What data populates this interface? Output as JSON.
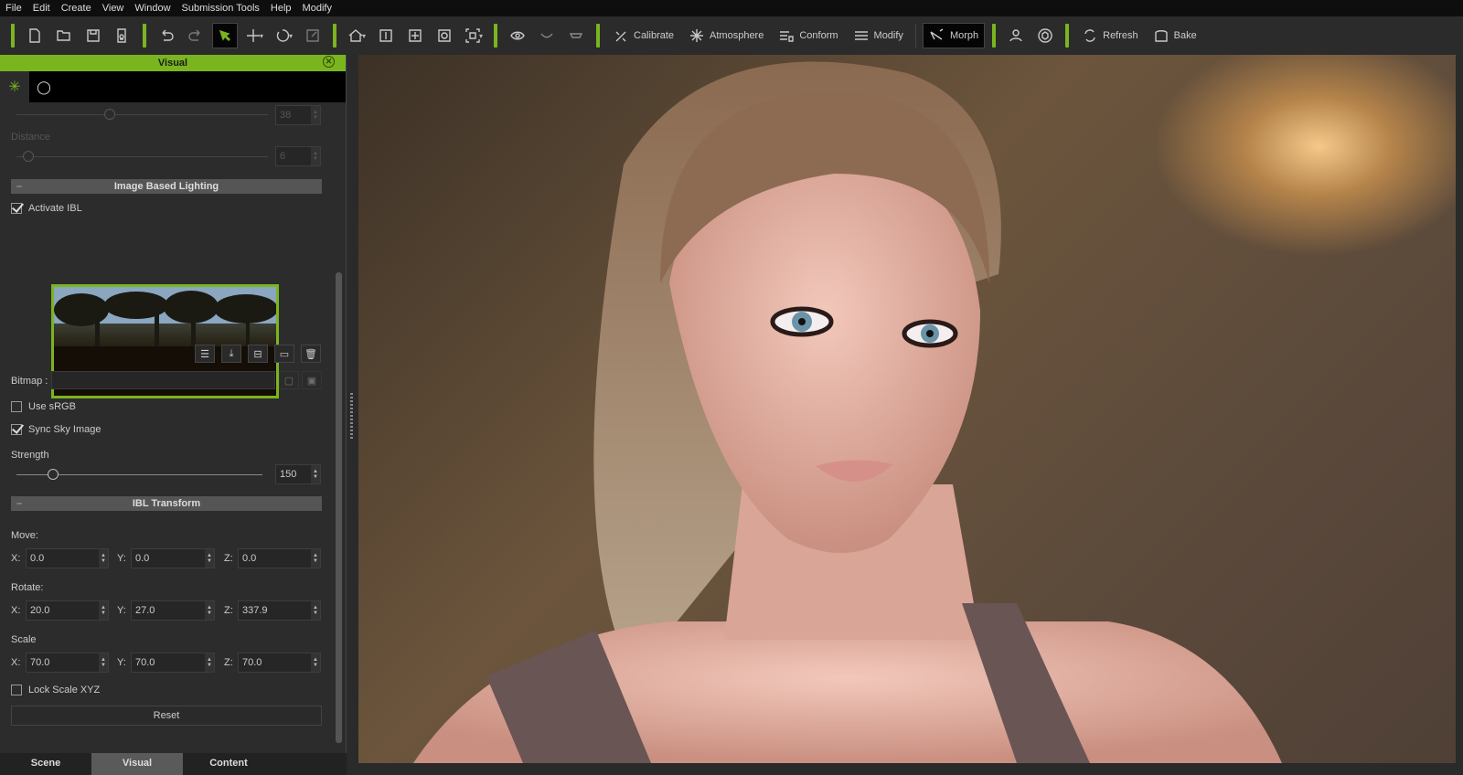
{
  "menu": [
    "File",
    "Edit",
    "Create",
    "View",
    "Window",
    "Submission Tools",
    "Help",
    "Modify"
  ],
  "toolbar": {
    "icons": [
      "new-file-icon",
      "open-folder-icon",
      "save-icon",
      "export-icon",
      "undo-icon",
      "redo-icon",
      "select-icon",
      "move-icon",
      "rotate-icon",
      "scale-icon",
      "home-camera-icon",
      "fit-vertical-icon",
      "fit-all-icon",
      "orbit-icon",
      "frame-icon",
      "eye-icon",
      "smooth-icon",
      "flat-icon"
    ],
    "calibrate": "Calibrate",
    "atmosphere": "Atmosphere",
    "conform": "Conform",
    "modify": "Modify",
    "morph": "Morph",
    "refresh": "Refresh",
    "bake": "Bake"
  },
  "panel": {
    "title": "Visual",
    "prev_slider_value": "38",
    "distance_label": "Distance",
    "distance_value": "6",
    "ibl_section": "Image Based Lighting",
    "activate_ibl": "Activate IBL",
    "activate_ibl_checked": true,
    "bitmap_label": "Bitmap :",
    "bitmap_value": "",
    "use_srgb": "Use sRGB",
    "use_srgb_checked": false,
    "sync_sky": "Sync Sky Image",
    "sync_sky_checked": true,
    "strength_label": "Strength",
    "strength_value": "150",
    "strength_fraction": 0.15,
    "ibl_transform_section": "IBL Transform",
    "move_label": "Move:",
    "move": {
      "x": "0.0",
      "y": "0.0",
      "z": "0.0"
    },
    "rotate_label": "Rotate:",
    "rotate": {
      "x": "20.0",
      "y": "27.0",
      "z": "337.9"
    },
    "scale_label": "Scale",
    "scale": {
      "x": "70.0",
      "y": "70.0",
      "z": "70.0"
    },
    "axis_x": "X:",
    "axis_y": "Y:",
    "axis_z": "Z:",
    "lock_scale": "Lock Scale XYZ",
    "lock_scale_checked": false,
    "reset": "Reset"
  },
  "bottom_tabs": [
    "Scene",
    "Visual",
    "Content"
  ],
  "active_bottom_tab": "Visual",
  "colors": {
    "accent": "#7ab520"
  }
}
